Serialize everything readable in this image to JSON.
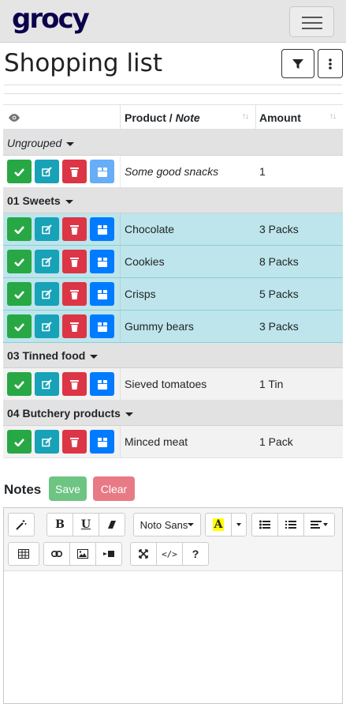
{
  "app": {
    "logo_text": "grocy"
  },
  "page": {
    "title": "Shopping list"
  },
  "table": {
    "headers": {
      "product": "Product / ",
      "note": "Note",
      "amount": "Amount",
      "sort_symbol": "↑↓"
    },
    "groups": [
      {
        "name": "Ungrouped",
        "italic": true,
        "rows": [
          {
            "product": "Some good snacks",
            "amount": "1",
            "italic": true,
            "style": "white"
          }
        ]
      },
      {
        "name": "01 Sweets",
        "italic": false,
        "rows": [
          {
            "product": "Chocolate",
            "amount": "3 Packs",
            "style": "teal"
          },
          {
            "product": "Cookies",
            "amount": "8 Packs",
            "style": "teal"
          },
          {
            "product": "Crisps",
            "amount": "5 Packs",
            "style": "teal"
          },
          {
            "product": "Gummy bears",
            "amount": "3 Packs",
            "style": "teal"
          }
        ]
      },
      {
        "name": "03 Tinned food",
        "italic": false,
        "rows": [
          {
            "product": "Sieved tomatoes",
            "amount": "1 Tin",
            "style": "grey"
          }
        ]
      },
      {
        "name": "04 Butchery products",
        "italic": false,
        "rows": [
          {
            "product": "Minced meat",
            "amount": "1 Pack",
            "style": "grey"
          }
        ]
      }
    ]
  },
  "notes": {
    "label": "Notes",
    "save_label": "Save",
    "clear_label": "Clear",
    "font_name": "Noto Sans",
    "bold_glyph": "B",
    "underline_glyph": "U",
    "help_glyph": "?",
    "codeview_glyph": "</>"
  },
  "colors": {
    "success": "#28a745",
    "info": "#17a2b8",
    "danger": "#dc3545",
    "primary": "#007bff",
    "row_highlight": "#bee5eb"
  }
}
